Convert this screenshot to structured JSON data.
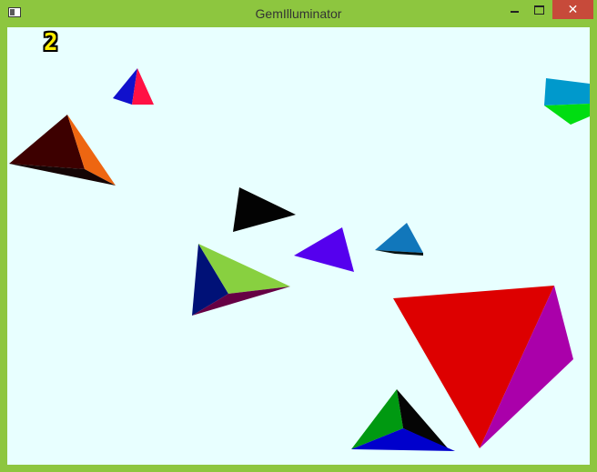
{
  "window": {
    "title": "GemIlluminator",
    "close_glyph": "✕"
  },
  "hud": {
    "score": "2"
  },
  "colors": {
    "frame": "#8dc63f",
    "background": "#e8ffff",
    "score": "#ffee00"
  }
}
